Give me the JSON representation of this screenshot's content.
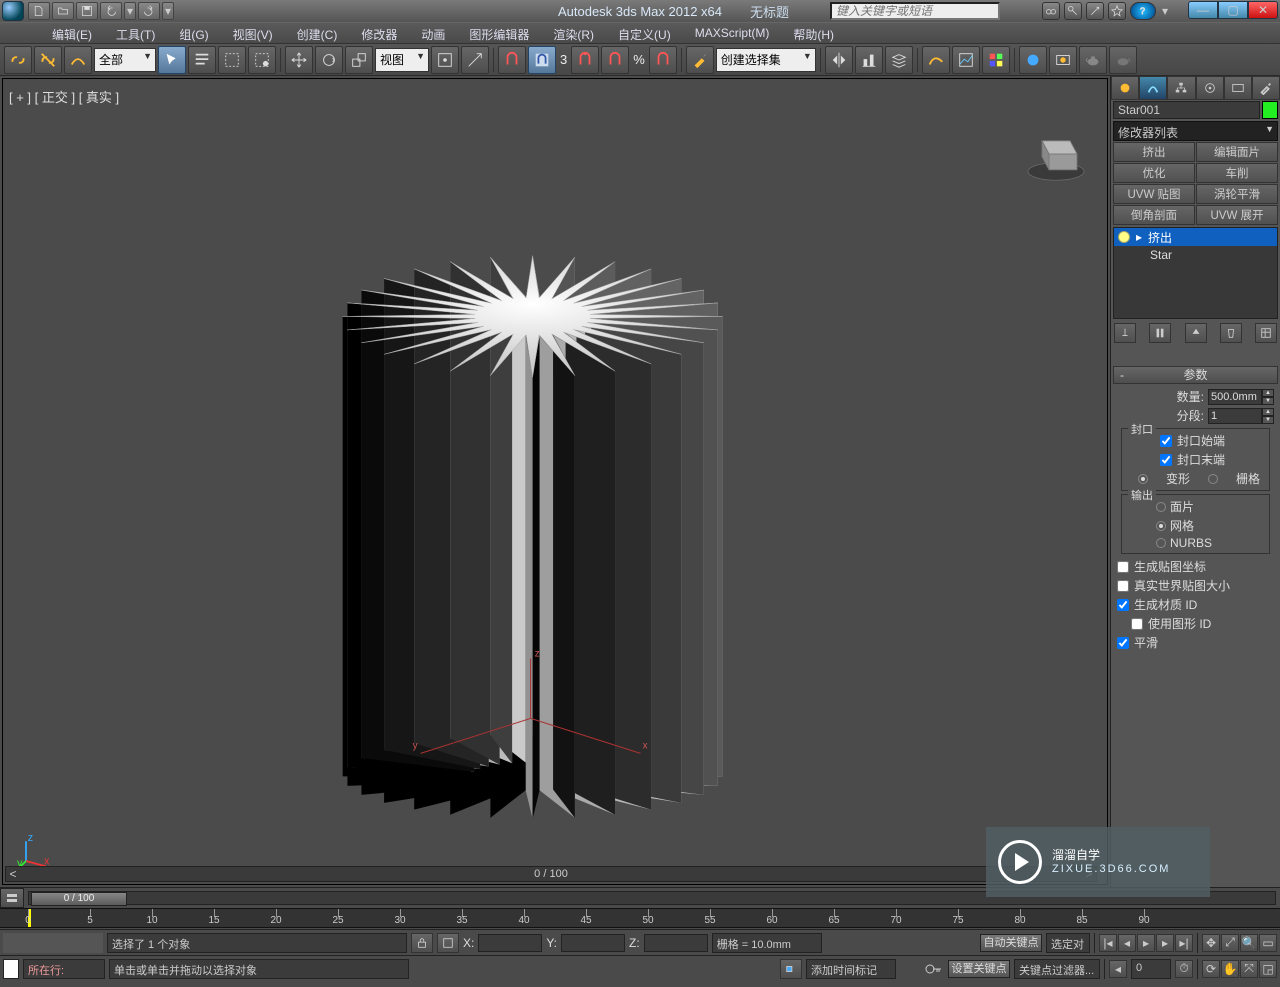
{
  "title": "Autodesk 3ds Max  2012 x64",
  "doc": "无标题",
  "search_placeholder": "键入关键字或短语",
  "menus": [
    "编辑(E)",
    "工具(T)",
    "组(G)",
    "视图(V)",
    "创建(C)",
    "修改器",
    "动画",
    "图形编辑器",
    "渲染(R)",
    "自定义(U)",
    "MAXScript(M)",
    "帮助(H)"
  ],
  "toolbar": {
    "filter": "全部",
    "viewmode": "视图",
    "namedset": "创建选择集"
  },
  "viewport_label": "[ + ] [ 正交 ] [ 真实 ]",
  "scroll_label": "0 / 100",
  "cmd": {
    "obj_name": "Star001",
    "modifier_dd": "修改器列表",
    "buttons": [
      "挤出",
      "编辑面片",
      "优化",
      "车削",
      "UVW 贴图",
      "涡轮平滑",
      "倒角剖面",
      "UVW 展开"
    ],
    "stack": [
      "挤出",
      "Star"
    ],
    "rollout": "参数",
    "quantity_label": "数量:",
    "quantity": "500.0mm",
    "seg_label": "分段:",
    "seg": "1",
    "cap": "封口",
    "cap_start": "封口始端",
    "cap_end": "封口末端",
    "morph": "变形",
    "grid": "栅格",
    "output": "输出",
    "o_patch": "面片",
    "o_mesh": "网格",
    "o_nurbs": "NURBS",
    "cb1": "生成贴图坐标",
    "cb2": "真实世界贴图大小",
    "cb3": "生成材质 ID",
    "cb4": "使用图形 ID",
    "cb5": "平滑"
  },
  "timeline": {
    "pos": "0 / 100",
    "max": 100,
    "ticks": [
      0,
      5,
      10,
      15,
      20,
      25,
      30,
      35,
      40,
      45,
      50,
      55,
      60,
      65,
      70,
      75,
      80,
      85,
      90
    ]
  },
  "status": {
    "sel": "选择了 1 个对象",
    "hint": "单击或单击并拖动以选择对象",
    "now": "所在行:",
    "grid": "栅格 = 10.0mm",
    "autokey": "自动关键点",
    "setkey": "设置关键点",
    "keyfilter": "关键点过滤器...",
    "seldd": "选定对",
    "addmarker": "添加时间标记",
    "frame": "0"
  },
  "watermark": {
    "brand": "溜溜自学",
    "url": "ZIXUE.3D66.COM"
  }
}
